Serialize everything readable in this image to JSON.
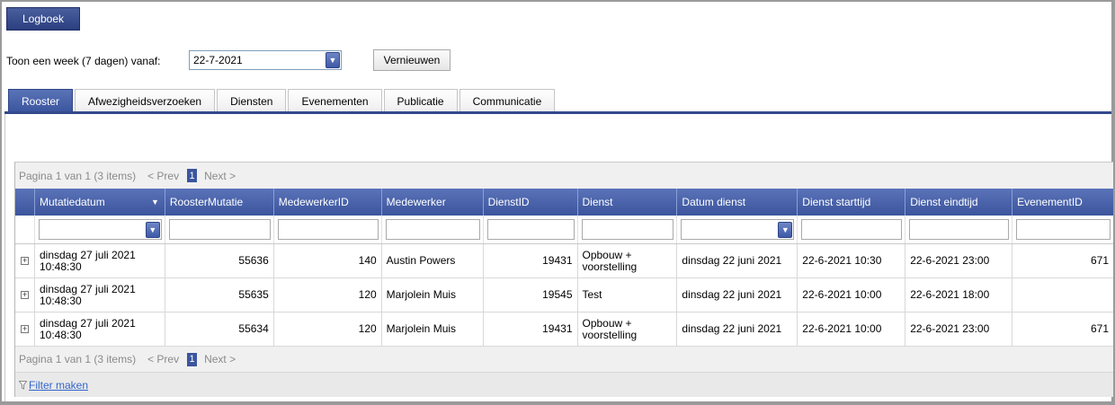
{
  "toolbar": {
    "logboek_label": "Logboek"
  },
  "week": {
    "label": "Toon een week (7 dagen) vanaf:",
    "date_value": "22-7-2021",
    "refresh_label": "Vernieuwen"
  },
  "tabs": [
    {
      "label": "Rooster",
      "active": true
    },
    {
      "label": "Afwezigheidsverzoeken"
    },
    {
      "label": "Diensten"
    },
    {
      "label": "Evenementen"
    },
    {
      "label": "Publicatie"
    },
    {
      "label": "Communicatie"
    }
  ],
  "pager": {
    "info": "Pagina 1 van 1 (3 items)",
    "prev": "< Prev",
    "page": "1",
    "next": "Next >"
  },
  "columns": [
    "Mutatiedatum",
    "RoosterMutatie",
    "MedewerkerID",
    "Medewerker",
    "DienstID",
    "Dienst",
    "Datum dienst",
    "Dienst starttijd",
    "Dienst eindtijd",
    "EvenementID"
  ],
  "rows": [
    {
      "mutatiedatum_line1": "dinsdag 27 juli 2021",
      "mutatiedatum_line2": "10:48:30",
      "roostermutatie": "55636",
      "medewerkerid": "140",
      "medewerker": "Austin Powers",
      "dienstid": "19431",
      "dienst_line1": "Opbouw +",
      "dienst_line2": "voorstelling",
      "datum_dienst": "dinsdag 22 juni 2021",
      "starttijd": "22-6-2021 10:30",
      "eindtijd": "22-6-2021 23:00",
      "evenementid": "671"
    },
    {
      "mutatiedatum_line1": "dinsdag 27 juli 2021",
      "mutatiedatum_line2": "10:48:30",
      "roostermutatie": "55635",
      "medewerkerid": "120",
      "medewerker": "Marjolein Muis",
      "dienstid": "19545",
      "dienst_line1": "Test",
      "dienst_line2": "",
      "datum_dienst": "dinsdag 22 juni 2021",
      "starttijd": "22-6-2021 10:00",
      "eindtijd": "22-6-2021 18:00",
      "evenementid": ""
    },
    {
      "mutatiedatum_line1": "dinsdag 27 juli 2021",
      "mutatiedatum_line2": "10:48:30",
      "roostermutatie": "55634",
      "medewerkerid": "120",
      "medewerker": "Marjolein Muis",
      "dienstid": "19431",
      "dienst_line1": "Opbouw +",
      "dienst_line2": "voorstelling",
      "datum_dienst": "dinsdag 22 juni 2021",
      "starttijd": "22-6-2021 10:00",
      "eindtijd": "22-6-2021 23:00",
      "evenementid": "671"
    }
  ],
  "filter_link": "Filter maken",
  "icons": {
    "dropdown": "chevron-down-icon",
    "sort": "sort-descending-icon",
    "expand": "expand-plus-icon",
    "filter": "filter-funnel-icon"
  },
  "colors": {
    "accent": "#3b559e",
    "tab_line": "#34498c",
    "link": "#3366cc"
  }
}
